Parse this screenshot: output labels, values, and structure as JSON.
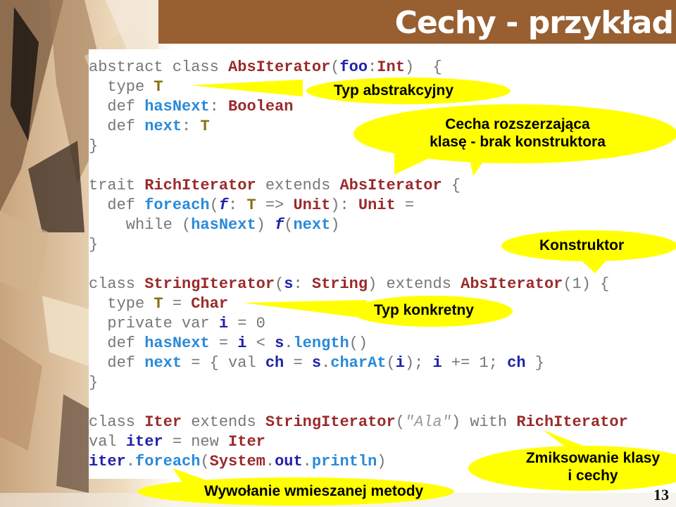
{
  "slide": {
    "title": "Cechy - przykład",
    "page_number": "13",
    "colors": {
      "title_bar": "#985f31",
      "callout_fill": "#ffff00",
      "keyword": "#777777",
      "type_name": "#9b2a2a",
      "abstract_type": "#8a6f14",
      "method": "#2a8ad8",
      "variable": "#2222aa"
    }
  },
  "code": {
    "block1": [
      [
        [
          "kw",
          "abstract class "
        ],
        [
          "ty",
          "AbsIterator"
        ],
        [
          "pl",
          "("
        ],
        [
          "vr",
          "foo"
        ],
        [
          "pl",
          ":"
        ],
        [
          "ty",
          "Int"
        ],
        [
          "pl",
          ")  {"
        ]
      ],
      [
        [
          "kw",
          "  type "
        ],
        [
          "ab",
          "T"
        ]
      ],
      [
        [
          "kw",
          "  def "
        ],
        [
          "fn",
          "hasNext"
        ],
        [
          "pl",
          ": "
        ],
        [
          "ty",
          "Boolean"
        ]
      ],
      [
        [
          "kw",
          "  def "
        ],
        [
          "fn",
          "next"
        ],
        [
          "pl",
          ": "
        ],
        [
          "ab",
          "T"
        ]
      ],
      [
        [
          "pl",
          "}"
        ]
      ]
    ],
    "block2": [
      [
        [
          "kw",
          "trait "
        ],
        [
          "ty",
          "RichIterator"
        ],
        [
          "kw",
          " extends "
        ],
        [
          "ty",
          "AbsIterator"
        ],
        [
          "pl",
          " {"
        ]
      ],
      [
        [
          "kw",
          "  def "
        ],
        [
          "fn",
          "foreach"
        ],
        [
          "pl",
          "("
        ],
        [
          "it",
          "f"
        ],
        [
          "pl",
          ": "
        ],
        [
          "ab",
          "T"
        ],
        [
          "pl",
          " => "
        ],
        [
          "ty",
          "Unit"
        ],
        [
          "pl",
          "): "
        ],
        [
          "ty",
          "Unit"
        ],
        [
          "pl",
          " ="
        ]
      ],
      [
        [
          "kw",
          "    while "
        ],
        [
          "pl",
          "("
        ],
        [
          "fn",
          "hasNext"
        ],
        [
          "pl",
          ") "
        ],
        [
          "it",
          "f"
        ],
        [
          "pl",
          "("
        ],
        [
          "fn",
          "next"
        ],
        [
          "pl",
          ")"
        ]
      ],
      [
        [
          "pl",
          "}"
        ]
      ]
    ],
    "block3": [
      [
        [
          "kw",
          "class "
        ],
        [
          "ty",
          "StringIterator"
        ],
        [
          "pl",
          "("
        ],
        [
          "vr",
          "s"
        ],
        [
          "pl",
          ": "
        ],
        [
          "ty",
          "String"
        ],
        [
          "pl",
          ") "
        ],
        [
          "kw",
          "extends "
        ],
        [
          "ty",
          "AbsIterator"
        ],
        [
          "pl",
          "(1) {"
        ]
      ],
      [
        [
          "kw",
          "  type "
        ],
        [
          "ab",
          "T"
        ],
        [
          "pl",
          " = "
        ],
        [
          "ty",
          "Char"
        ]
      ],
      [
        [
          "kw",
          "  private var "
        ],
        [
          "vr",
          "i"
        ],
        [
          "pl",
          " = 0"
        ]
      ],
      [
        [
          "kw",
          "  def "
        ],
        [
          "fn",
          "hasNext"
        ],
        [
          "pl",
          " = "
        ],
        [
          "vr",
          "i"
        ],
        [
          "pl",
          " < "
        ],
        [
          "vr",
          "s"
        ],
        [
          "pl",
          "."
        ],
        [
          "fn",
          "length"
        ],
        [
          "pl",
          "()"
        ]
      ],
      [
        [
          "kw",
          "  def "
        ],
        [
          "fn",
          "next"
        ],
        [
          "pl",
          " = { "
        ],
        [
          "kw",
          "val "
        ],
        [
          "vr",
          "ch"
        ],
        [
          "pl",
          " = "
        ],
        [
          "vr",
          "s"
        ],
        [
          "pl",
          "."
        ],
        [
          "fn",
          "charAt"
        ],
        [
          "pl",
          "("
        ],
        [
          "vr",
          "i"
        ],
        [
          "pl",
          "); "
        ],
        [
          "vr",
          "i"
        ],
        [
          "pl",
          " += 1; "
        ],
        [
          "vr",
          "ch"
        ],
        [
          "pl",
          " }"
        ]
      ],
      [
        [
          "pl",
          "}"
        ]
      ]
    ],
    "block4": [
      [
        [
          "kw",
          "class "
        ],
        [
          "ty",
          "Iter"
        ],
        [
          "kw",
          " extends "
        ],
        [
          "ty",
          "StringIterator"
        ],
        [
          "pl",
          "("
        ],
        [
          "st",
          "\"Ala\""
        ],
        [
          "pl",
          ") "
        ],
        [
          "kw",
          "with "
        ],
        [
          "ty",
          "RichIterator"
        ]
      ],
      [
        [
          "kw",
          "val "
        ],
        [
          "vr",
          "iter"
        ],
        [
          "pl",
          " = "
        ],
        [
          "kw",
          "new "
        ],
        [
          "ty",
          "Iter"
        ]
      ],
      [
        [
          "vr",
          "iter"
        ],
        [
          "pl",
          "."
        ],
        [
          "fn",
          "foreach"
        ],
        [
          "pl",
          "("
        ],
        [
          "ty",
          "System"
        ],
        [
          "pl",
          "."
        ],
        [
          "vr",
          "out"
        ],
        [
          "pl",
          "."
        ],
        [
          "fn",
          "println"
        ],
        [
          "pl",
          ")"
        ]
      ]
    ]
  },
  "callouts": {
    "abstract_type": "Typ abstrakcyjny",
    "trait_extends_line1": "Cecha rozszerzająca",
    "trait_extends_line2": "klasę - brak konstruktora",
    "constructor": "Konstruktor",
    "concrete_type": "Typ konkretny",
    "mixin_line1": "Zmiksowanie klasy",
    "mixin_line2": "i cechy",
    "mixed_method_call": "Wywołanie wmieszanej metody"
  }
}
